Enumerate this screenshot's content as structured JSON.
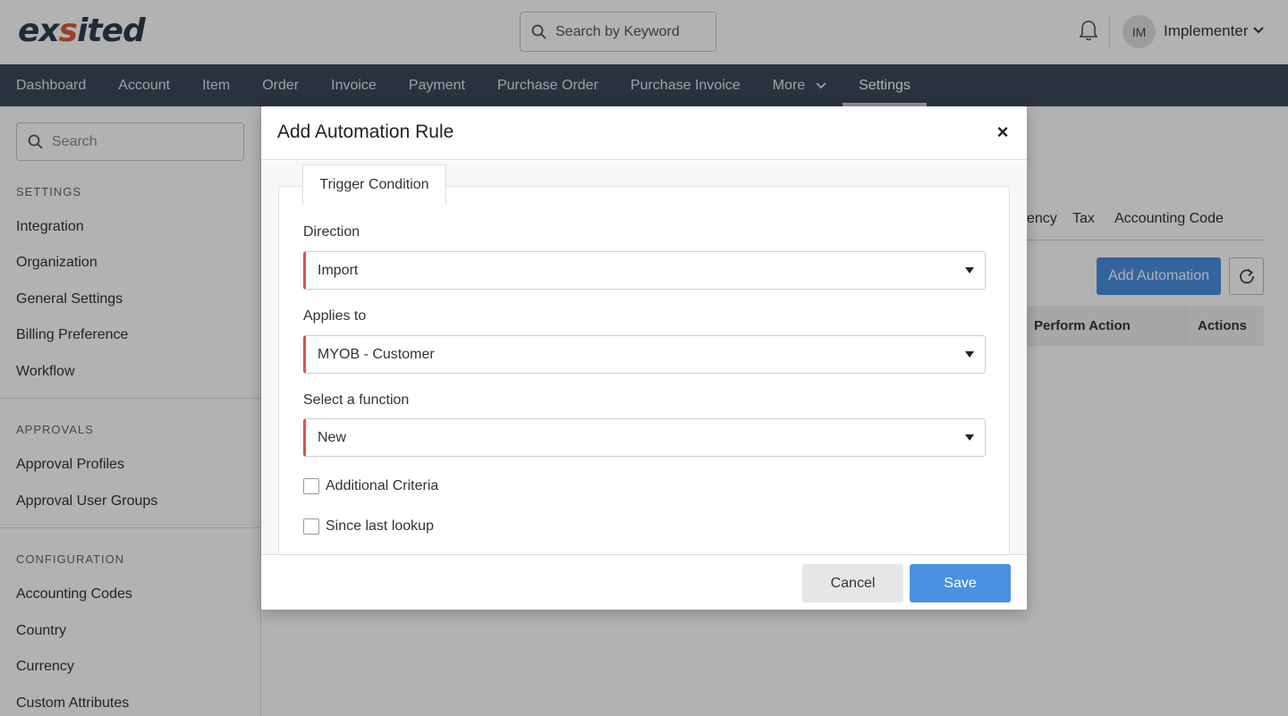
{
  "header": {
    "logo_text_pre": "ex",
    "logo_text_dot": "s",
    "logo_text_post": "ited",
    "search_placeholder": "Search by Keyword",
    "user_initials": "IM",
    "user_name": "Implementer"
  },
  "nav": {
    "items": [
      "Dashboard",
      "Account",
      "Item",
      "Order",
      "Invoice",
      "Payment",
      "Purchase Order",
      "Purchase Invoice"
    ],
    "more_label": "More",
    "settings_label": "Settings"
  },
  "sidebar": {
    "search_placeholder": "Search",
    "settings_heading": "SETTINGS",
    "settings_items": [
      "Integration",
      "Organization",
      "General Settings",
      "Billing Preference",
      "Workflow"
    ],
    "approvals_heading": "APPROVALS",
    "approvals_items": [
      "Approval Profiles",
      "Approval User Groups"
    ],
    "configuration_heading": "CONFIGURATION",
    "configuration_items": [
      "Accounting Codes",
      "Country",
      "Currency",
      "Custom Attributes"
    ]
  },
  "main": {
    "tabs_visible": [
      "ency",
      "Tax",
      "Accounting Code"
    ],
    "add_button": "Add Automation",
    "table_headers": [
      "Perform Action",
      "Actions"
    ]
  },
  "modal": {
    "title": "Add Automation Rule",
    "close_symbol": "×",
    "tab_label": "Trigger Condition",
    "direction_label": "Direction",
    "direction_value": "Import",
    "applies_label": "Applies to",
    "applies_value": "MYOB - Customer",
    "function_label": "Select a function",
    "function_value": "New",
    "checkbox_additional": "Additional Criteria",
    "checkbox_since": "Since last lookup",
    "cancel_label": "Cancel",
    "save_label": "Save"
  },
  "colors": {
    "nav_bg": "#3b4a5a",
    "primary": "#4a90e2",
    "required_accent": "#d9534f"
  }
}
